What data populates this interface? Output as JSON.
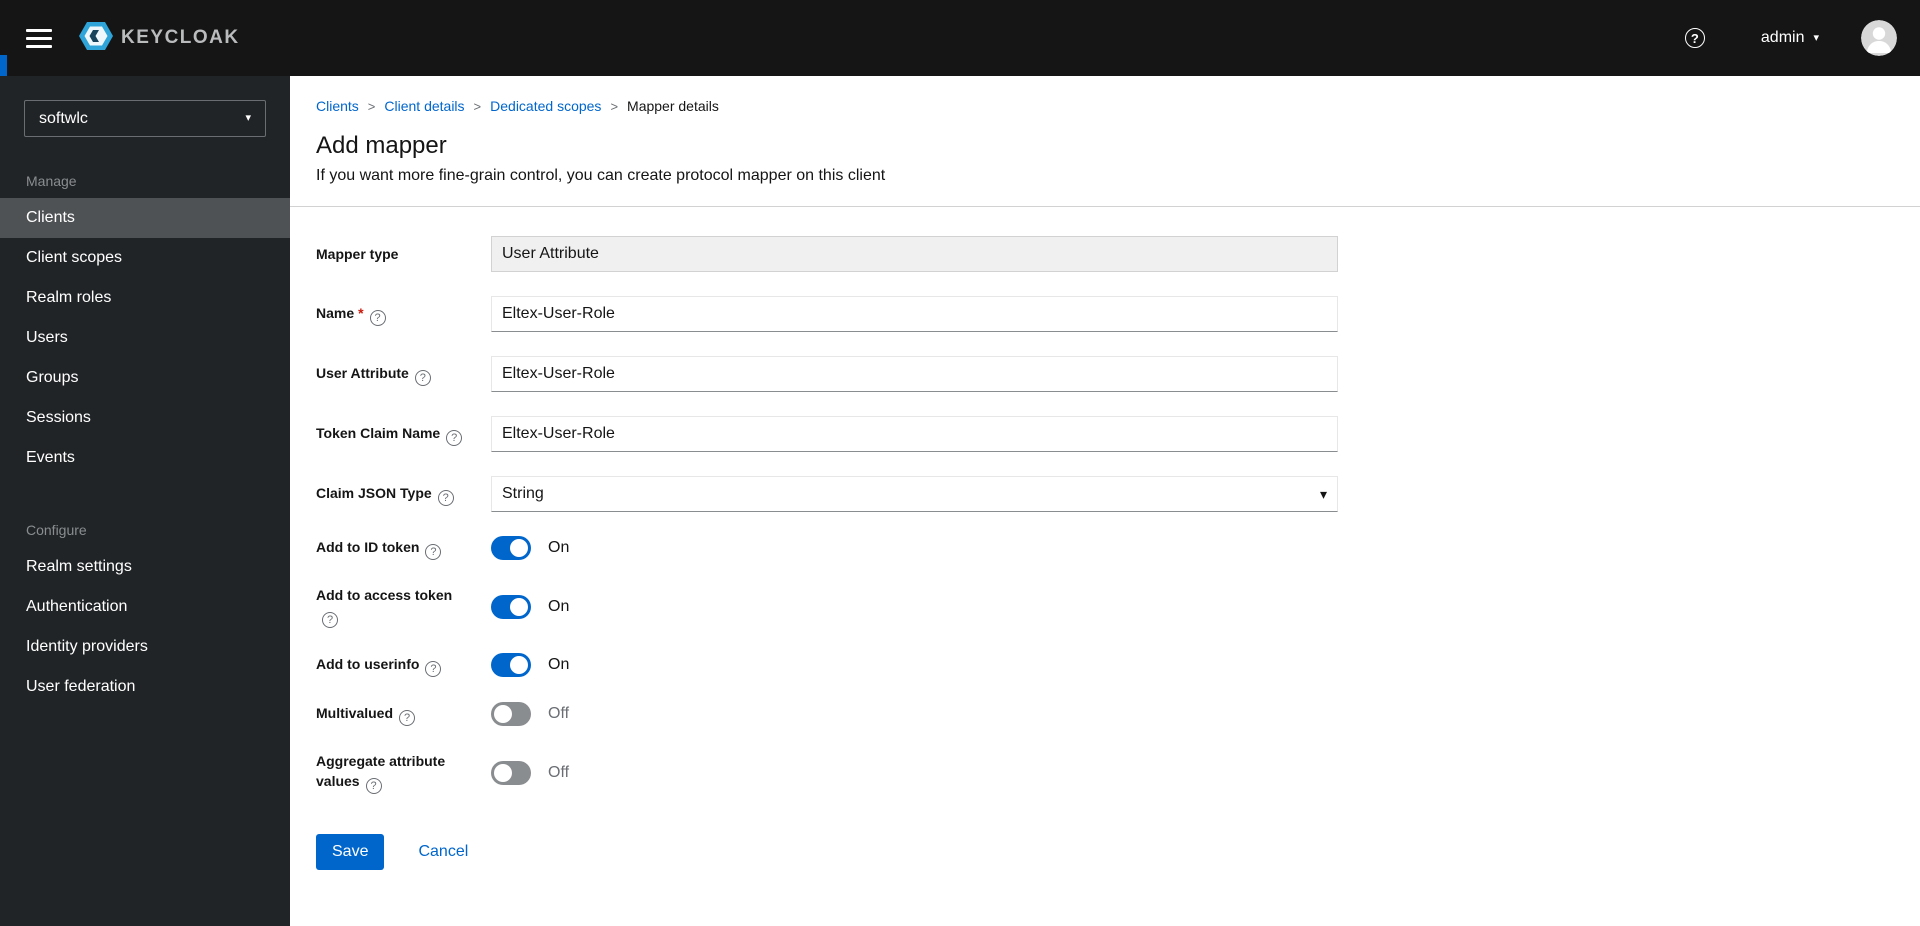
{
  "header": {
    "brand": "KEYCLOAK",
    "username": "admin"
  },
  "sidebar": {
    "realm": "softwlc",
    "sections": [
      {
        "label": "Manage",
        "items": [
          {
            "label": "Clients",
            "active": true
          },
          {
            "label": "Client scopes",
            "active": false
          },
          {
            "label": "Realm roles",
            "active": false
          },
          {
            "label": "Users",
            "active": false
          },
          {
            "label": "Groups",
            "active": false
          },
          {
            "label": "Sessions",
            "active": false
          },
          {
            "label": "Events",
            "active": false
          }
        ]
      },
      {
        "label": "Configure",
        "items": [
          {
            "label": "Realm settings",
            "active": false
          },
          {
            "label": "Authentication",
            "active": false
          },
          {
            "label": "Identity providers",
            "active": false
          },
          {
            "label": "User federation",
            "active": false
          }
        ]
      }
    ]
  },
  "breadcrumb": {
    "items": [
      {
        "label": "Clients",
        "link": true
      },
      {
        "label": "Client details",
        "link": true
      },
      {
        "label": "Dedicated scopes",
        "link": true
      },
      {
        "label": "Mapper details",
        "link": false
      }
    ]
  },
  "page": {
    "title": "Add mapper",
    "subtitle": "If you want more fine-grain control, you can create protocol mapper on this client"
  },
  "form": {
    "required_marker": "*",
    "fields": {
      "mapper_type": {
        "label": "Mapper type",
        "value": "User Attribute"
      },
      "name": {
        "label": "Name",
        "value": "Eltex-User-Role",
        "required": true
      },
      "user_attribute": {
        "label": "User Attribute",
        "value": "Eltex-User-Role"
      },
      "token_claim_name": {
        "label": "Token Claim Name",
        "value": "Eltex-User-Role"
      },
      "claim_json_type": {
        "label": "Claim JSON Type",
        "value": "String"
      },
      "add_to_id_token": {
        "label": "Add to ID token",
        "state": "On",
        "on": true
      },
      "add_to_access_token": {
        "label": "Add to access token",
        "state": "On",
        "on": true
      },
      "add_to_userinfo": {
        "label": "Add to userinfo",
        "state": "On",
        "on": true
      },
      "multivalued": {
        "label": "Multivalued",
        "state": "Off",
        "on": false
      },
      "aggregate_attribute_values": {
        "label": "Aggregate attribute values",
        "state": "Off",
        "on": false
      }
    },
    "actions": {
      "save": "Save",
      "cancel": "Cancel"
    }
  },
  "colors": {
    "accent": "#0066cc",
    "header_bg": "#151515",
    "sidebar_bg": "#212427",
    "active_item_bg": "#4f5255",
    "toggle_on": "#0066cc",
    "toggle_off": "#8a8d90",
    "required": "#c9190b"
  }
}
